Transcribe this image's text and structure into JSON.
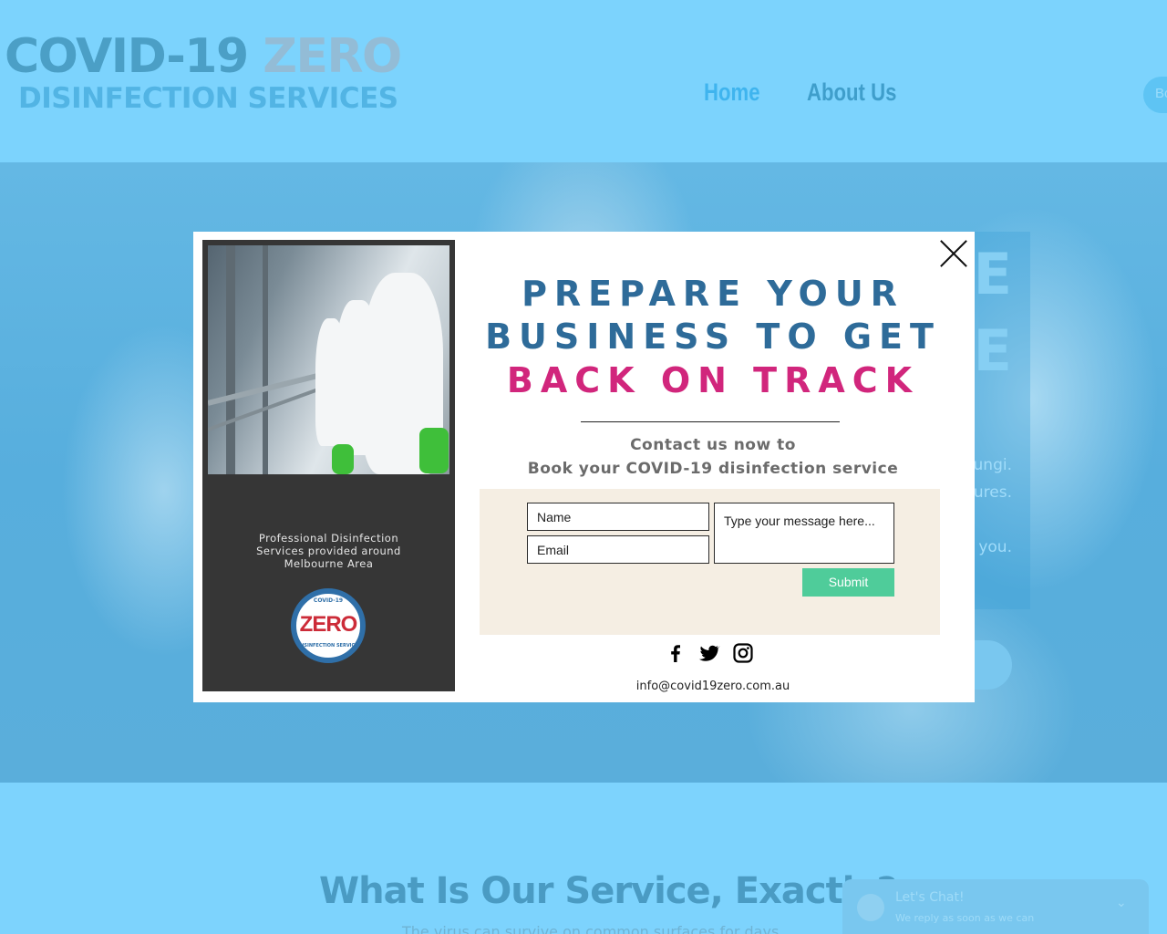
{
  "header": {
    "logo_main_prefix": "COVID-19 ",
    "logo_main_suffix": "ZERO",
    "logo_sub": "DISINFECTION SERVICES",
    "nav": {
      "home": "Home",
      "about": "About Us"
    },
    "book_button": "Bo"
  },
  "hero": {
    "big_line_1": "CE",
    "big_line_2": "CE",
    "text_1": "ungi.",
    "text_2": "ures.",
    "text_3": "r you."
  },
  "section": {
    "title": "What Is Our Service, Exactly?",
    "text": "The virus can survive on common surfaces for days"
  },
  "chat": {
    "title": "Let's Chat!",
    "subtitle": "We reply as soon as we can"
  },
  "modal": {
    "headline_1": "PREPARE YOUR",
    "headline_2": "BUSINESS TO GET",
    "headline_3": "BACK ON TRACK",
    "contact_1": "Contact us now to",
    "contact_2": "Book your COVID-19 disinfection service",
    "form": {
      "name_placeholder": "Name",
      "email_placeholder": "Email",
      "message_placeholder": "Type your message here...",
      "submit_label": "Submit"
    },
    "card": {
      "line_1": "Professional Disinfection",
      "line_2": "Services provided around",
      "line_3": "Melbourne Area",
      "badge_top": "COVID-19",
      "badge_zero": "ZERO",
      "badge_bottom": "DISINFECTION SERVICE"
    },
    "socials": [
      "facebook-icon",
      "twitter-icon",
      "instagram-icon"
    ],
    "email": "info@covid19zero.com.au"
  },
  "colors": {
    "page_bg": "#7dd3fd",
    "headline_blue": "#2e6b99",
    "headline_pink": "#d1267c",
    "submit_green": "#4fcc9a",
    "form_bg": "#f5eee3"
  }
}
